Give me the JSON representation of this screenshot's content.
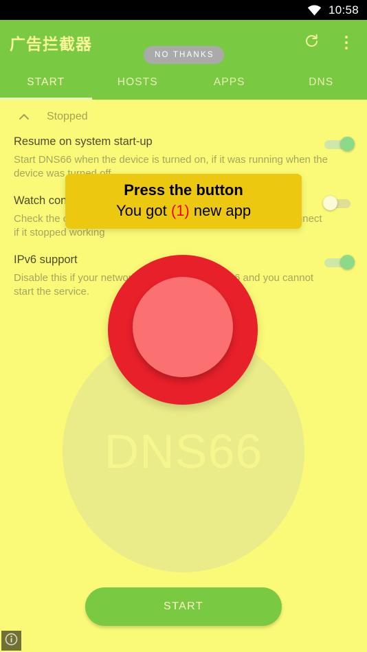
{
  "status_bar": {
    "time": "10:58",
    "wifi_icon": "wifi-icon"
  },
  "app_bar": {
    "title": "广告拦截器",
    "no_thanks_label": "NO THANKS",
    "refresh_icon": "refresh-icon",
    "overflow_icon": "overflow-menu-icon"
  },
  "tabs": [
    {
      "label": "START",
      "active": true
    },
    {
      "label": "HOSTS",
      "active": false
    },
    {
      "label": "APPS",
      "active": false
    },
    {
      "label": "DNS",
      "active": false
    }
  ],
  "status_section": {
    "collapse_icon": "chevron-up-icon",
    "label": "Stopped"
  },
  "settings": [
    {
      "title": "Resume on system start-up",
      "description": "Start DNS66 when the device is turned on, if it was running when the device was turned off",
      "toggle": "on"
    },
    {
      "title": "Watch connection",
      "description": "Check the connection in increasingly longer intervals and reconnect if it stopped working",
      "toggle": "off"
    },
    {
      "title": "IPv6 support",
      "description": "Disable this if your network does not support IPv6 and you cannot start the service.",
      "toggle": "on"
    }
  ],
  "logo": {
    "text": "DNS66"
  },
  "start_button": {
    "label": "START"
  },
  "tooltip": {
    "line1": "Press the button",
    "line2_before": "You got ",
    "count": "(1)",
    "line2_after": " new app"
  },
  "info_badge": {
    "icon": "info-icon"
  },
  "colors": {
    "app_bar_green": "#7ac943",
    "background_yellow": "#fafa78",
    "logo_circle": "#e9ec88",
    "tooltip_yellow": "#ecc810",
    "tooltip_count_red": "#ee0000",
    "red_button_outer": "#e8202a",
    "red_button_inner": "#fb7070",
    "toggle_on": "#8ada8a",
    "title_yellow": "#f7f59a"
  }
}
